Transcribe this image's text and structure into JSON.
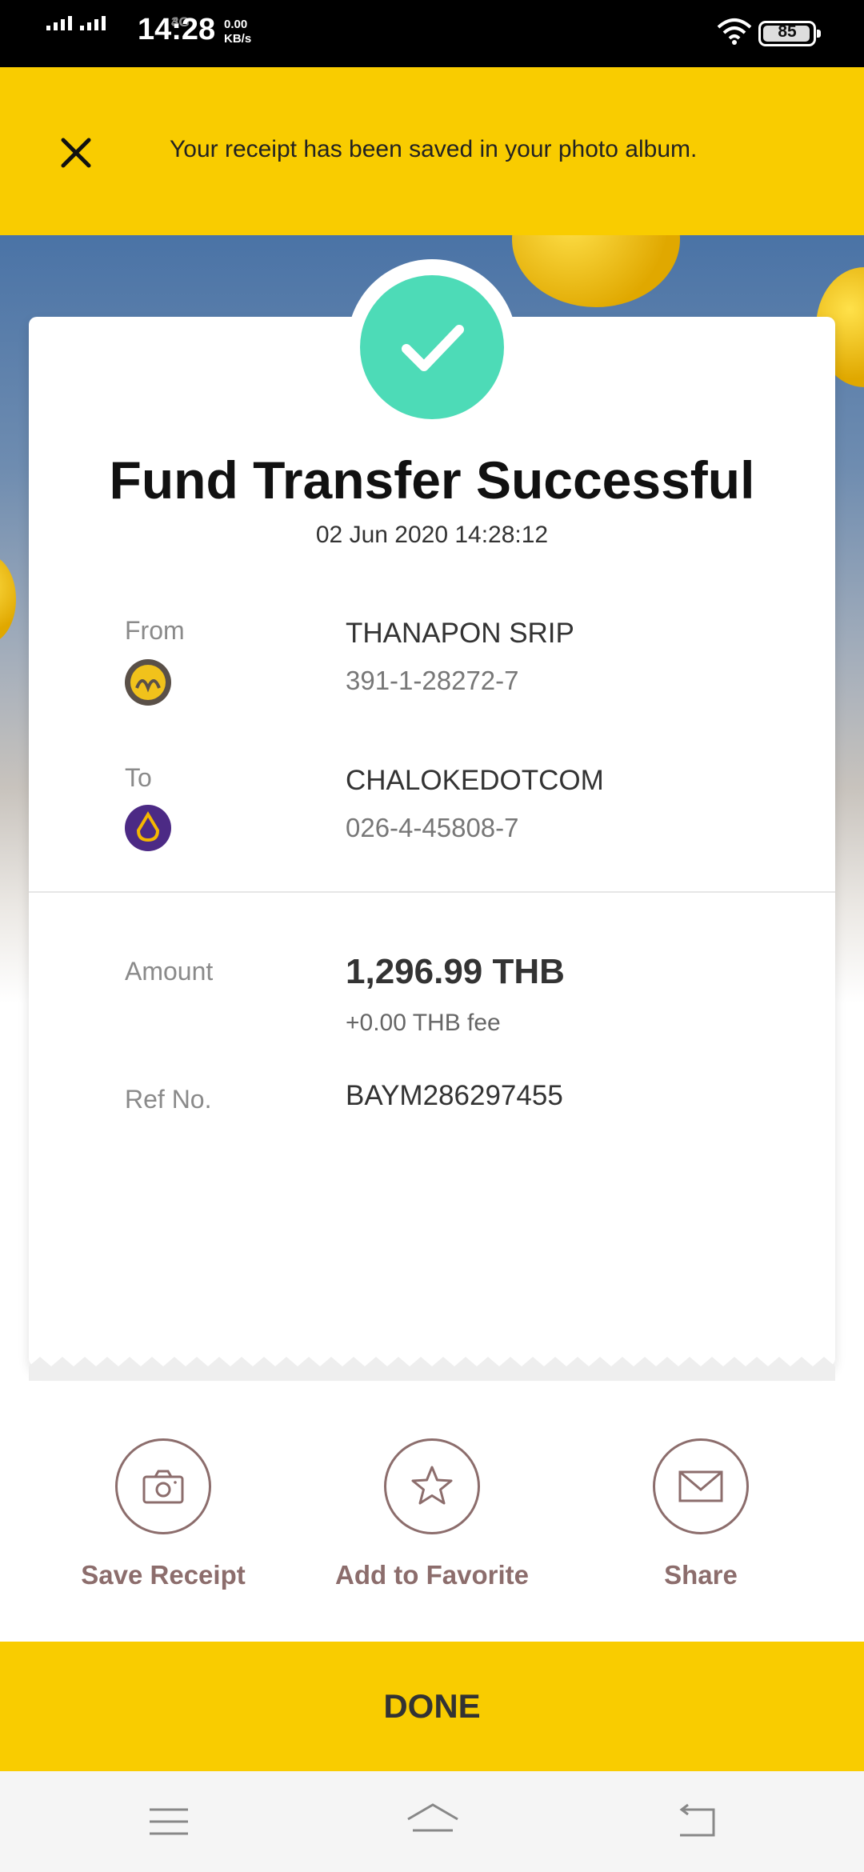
{
  "status_bar": {
    "network_1": "4G",
    "network_2": "3G",
    "time": "14:28",
    "speed_value": "0.00",
    "speed_unit": "KB/s",
    "battery": "85"
  },
  "banner": {
    "message": "Your receipt has been saved in your photo album.",
    "close_icon": "close-icon"
  },
  "receipt": {
    "status_icon": "checkmark-icon",
    "status_color": "#4ddbb7",
    "title": "Fund Transfer Successful",
    "datetime": "02 Jun 2020 14:28:12",
    "from": {
      "label": "From",
      "name": "THANAPON SRIP",
      "account": "391-1-28272-7",
      "bank_icon": "kbank-logo-icon",
      "bank_color": "#5a5048"
    },
    "to": {
      "label": "To",
      "name": "CHALOKEDOTCOM",
      "account": "026-4-45808-7",
      "bank_icon": "scb-logo-icon",
      "bank_color": "#4c2a85"
    },
    "amount_label": "Amount",
    "amount": "1,296.99 THB",
    "fee": "+0.00 THB fee",
    "ref_label": "Ref No.",
    "ref_no": "BAYM286297455"
  },
  "actions": [
    {
      "label": "Save Receipt",
      "icon": "camera-icon"
    },
    {
      "label": "Add to Favorite",
      "icon": "star-icon"
    },
    {
      "label": "Share",
      "icon": "envelope-icon"
    }
  ],
  "done_label": "DONE",
  "navbar": {
    "icons": [
      "menu-icon",
      "home-icon",
      "back-icon"
    ]
  },
  "colors": {
    "brand_yellow": "#f9cc00",
    "action_brown": "#8c6d6c"
  }
}
